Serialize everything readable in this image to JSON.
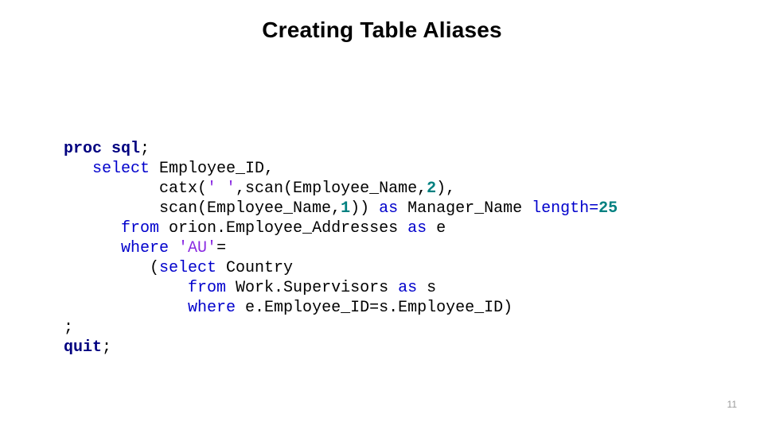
{
  "title": "Creating Table Aliases",
  "page_number": "11",
  "code": {
    "proc": "proc",
    "sql": "sql",
    "semi1": ";",
    "select": "select",
    "select_args": " Employee_ID,",
    "catx_pre": "          catx(",
    "str1": "' '",
    "catx_mid": ",scan(Employee_Name,",
    "num2a": "2",
    "catx_end": "),",
    "scan2_pre": "          scan(Employee_Name,",
    "num1": "1",
    "scan2_mid": ")) ",
    "as1": "as",
    "mgr": " Manager_Name ",
    "length": "length=",
    "num25": "25",
    "from1": "from",
    "from1_rest": " orion.Employee_Addresses ",
    "as2": "as",
    "alias_e": " e",
    "where1": "where",
    "where1_rest": " ",
    "str2": "'AU'",
    "eq": "=",
    "sub_open": "         (",
    "sub_select": "select",
    "sub_select_rest": " Country",
    "sub_from": "from",
    "sub_from_rest": " Work.Supervisors ",
    "as3": "as",
    "alias_s": " s",
    "sub_where": "where",
    "sub_where_rest": " e.Employee_ID=s.Employee_ID)",
    "semi2": ";",
    "quit": "quit",
    "semi3": ";"
  }
}
